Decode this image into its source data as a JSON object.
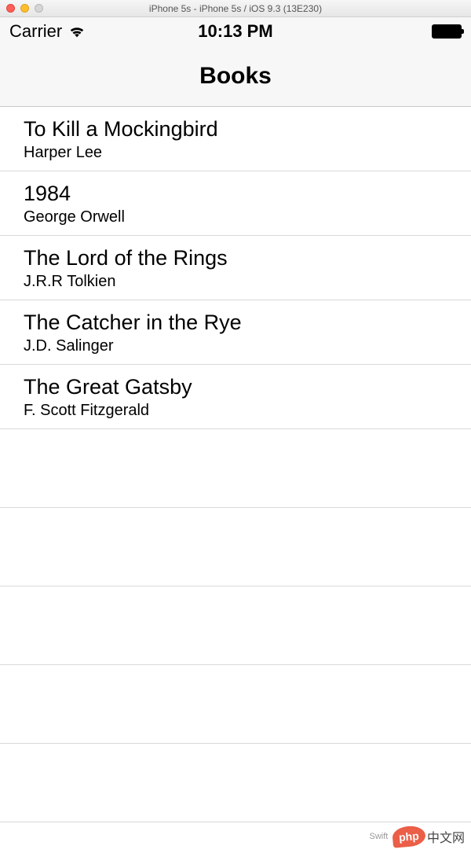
{
  "mac_titlebar": {
    "title": "iPhone 5s - iPhone 5s / iOS 9.3 (13E230)"
  },
  "status_bar": {
    "carrier": "Carrier",
    "time": "10:13 PM"
  },
  "nav": {
    "title": "Books"
  },
  "books": [
    {
      "title": "To Kill a Mockingbird",
      "author": "Harper Lee"
    },
    {
      "title": "1984",
      "author": "George Orwell"
    },
    {
      "title": "The Lord of the Rings",
      "author": "J.R.R Tolkien"
    },
    {
      "title": "The Catcher in the Rye",
      "author": "J.D. Salinger"
    },
    {
      "title": "The Great Gatsby",
      "author": "F. Scott Fitzgerald"
    }
  ],
  "watermark": {
    "badge": "php",
    "text": "中文网",
    "aux": "Swift"
  }
}
